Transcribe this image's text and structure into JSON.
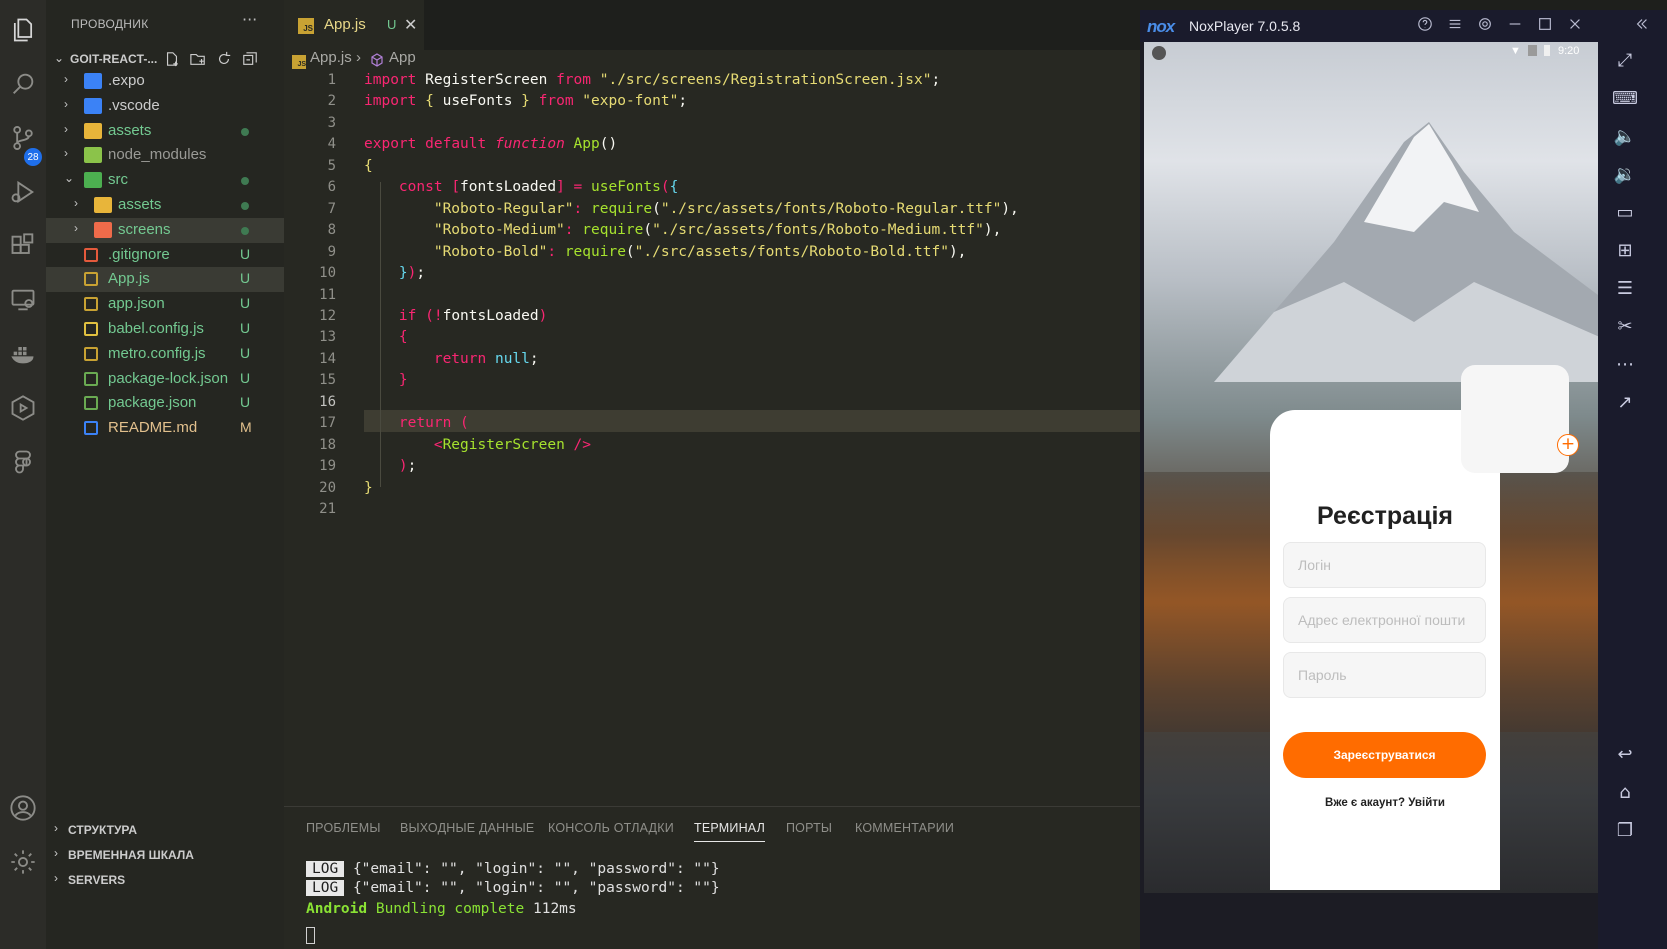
{
  "sidebar": {
    "title": "ПРОВОДНИК",
    "more": "···",
    "root": "GOIT-REACT-...",
    "items": [
      {
        "name": ".expo",
        "status": "",
        "indent": 1,
        "folder": true,
        "open": false,
        "color": "#3b82f6",
        "text_color": "#cccccc"
      },
      {
        "name": ".vscode",
        "status": "",
        "indent": 1,
        "folder": true,
        "open": false,
        "color": "#3b82f6",
        "text_color": "#cccccc"
      },
      {
        "name": "assets",
        "status": "dot",
        "indent": 1,
        "folder": true,
        "open": false,
        "color": "#e8b53a",
        "text_color": "#73c991"
      },
      {
        "name": "node_modules",
        "status": "",
        "indent": 1,
        "folder": true,
        "open": false,
        "color": "#8bc34a",
        "text_color": "#9a9a96"
      },
      {
        "name": "src",
        "status": "dot",
        "indent": 1,
        "folder": true,
        "open": true,
        "color": "#4caf50",
        "text_color": "#73c991"
      },
      {
        "name": "assets",
        "status": "dot",
        "indent": 2,
        "folder": true,
        "open": false,
        "color": "#e8b53a",
        "text_color": "#73c991"
      },
      {
        "name": "screens",
        "status": "dot",
        "indent": 2,
        "folder": true,
        "open": false,
        "color": "#ef6b4a",
        "text_color": "#73c991"
      },
      {
        "name": ".gitignore",
        "status": "U",
        "indent": 1,
        "folder": false,
        "color": "#e45a3c",
        "text_color": "#73c991"
      },
      {
        "name": "App.js",
        "status": "U",
        "indent": 1,
        "folder": false,
        "color": "#c8a233",
        "text_color": "#73c991"
      },
      {
        "name": "app.json",
        "status": "U",
        "indent": 1,
        "folder": false,
        "color": "#c8a233",
        "text_color": "#73c991"
      },
      {
        "name": "babel.config.js",
        "status": "U",
        "indent": 1,
        "folder": false,
        "color": "#e0c040",
        "text_color": "#73c991"
      },
      {
        "name": "metro.config.js",
        "status": "U",
        "indent": 1,
        "folder": false,
        "color": "#c8a233",
        "text_color": "#73c991"
      },
      {
        "name": "package-lock.json",
        "status": "U",
        "indent": 1,
        "folder": false,
        "color": "#6aaa52",
        "text_color": "#73c991"
      },
      {
        "name": "package.json",
        "status": "U",
        "indent": 1,
        "folder": false,
        "color": "#6aaa52",
        "text_color": "#73c991"
      },
      {
        "name": "README.md",
        "status": "M",
        "indent": 1,
        "folder": false,
        "color": "#3b82f6",
        "text_color": "#e2c08d"
      }
    ],
    "sections": [
      "СТРУКТУРА",
      "ВРЕМЕННАЯ ШКАЛА",
      "SERVERS"
    ]
  },
  "activity": {
    "scm_badge": "28"
  },
  "tab": {
    "name": "App.js",
    "status": "U",
    "close": "✕"
  },
  "breadcrumb": {
    "file": "App.js",
    "symbol": "App"
  },
  "editor": {
    "active_line": 16,
    "lines": [
      [
        [
          "kw",
          "import"
        ],
        [
          "br",
          " RegisterScreen "
        ],
        [
          "kw",
          "from"
        ],
        [
          "br",
          " "
        ],
        [
          "str",
          "\"./src/screens/RegistrationScreen.jsx\""
        ],
        [
          "br",
          ";"
        ]
      ],
      [
        [
          "kw",
          "import"
        ],
        [
          "br",
          " "
        ],
        [
          "ye",
          "{"
        ],
        [
          "br",
          " useFonts "
        ],
        [
          "ye",
          "}"
        ],
        [
          "br",
          " "
        ],
        [
          "kw",
          "from"
        ],
        [
          "br",
          " "
        ],
        [
          "str",
          "\"expo-font\""
        ],
        [
          "br",
          ";"
        ]
      ],
      [],
      [
        [
          "kw",
          "export"
        ],
        [
          "br",
          " "
        ],
        [
          "kw",
          "default"
        ],
        [
          "br",
          " "
        ],
        [
          "it",
          "function"
        ],
        [
          "br",
          " "
        ],
        [
          "fn",
          "App"
        ],
        [
          "br",
          "()"
        ]
      ],
      [
        [
          "ye",
          "{"
        ]
      ],
      [
        [
          "br",
          "    "
        ],
        [
          "kw",
          "const"
        ],
        [
          "br",
          " "
        ],
        [
          "kw",
          "["
        ],
        [
          "br",
          "fontsLoaded"
        ],
        [
          "kw",
          "]"
        ],
        [
          "br",
          " "
        ],
        [
          "kw",
          "="
        ],
        [
          "br",
          " "
        ],
        [
          "fn",
          "useFonts"
        ],
        [
          "kw",
          "("
        ],
        [
          "cn",
          "{"
        ]
      ],
      [
        [
          "br",
          "        "
        ],
        [
          "str",
          "\"Roboto-Regular\""
        ],
        [
          "kw",
          ":"
        ],
        [
          "br",
          " "
        ],
        [
          "fn",
          "require"
        ],
        [
          "br",
          "("
        ],
        [
          "str",
          "\"./src/assets/fonts/Roboto-Regular.ttf\""
        ],
        [
          "br",
          "),"
        ]
      ],
      [
        [
          "br",
          "        "
        ],
        [
          "str",
          "\"Roboto-Medium\""
        ],
        [
          "kw",
          ":"
        ],
        [
          "br",
          " "
        ],
        [
          "fn",
          "require"
        ],
        [
          "br",
          "("
        ],
        [
          "str",
          "\"./src/assets/fonts/Roboto-Medium.ttf\""
        ],
        [
          "br",
          "),"
        ]
      ],
      [
        [
          "br",
          "        "
        ],
        [
          "str",
          "\"Roboto-Bold\""
        ],
        [
          "kw",
          ":"
        ],
        [
          "br",
          " "
        ],
        [
          "fn",
          "require"
        ],
        [
          "br",
          "("
        ],
        [
          "str",
          "\"./src/assets/fonts/Roboto-Bold.ttf\""
        ],
        [
          "br",
          "),"
        ]
      ],
      [
        [
          "br",
          "    "
        ],
        [
          "cn",
          "}"
        ],
        [
          "kw",
          ")"
        ],
        [
          "br",
          ";"
        ]
      ],
      [],
      [
        [
          "br",
          "    "
        ],
        [
          "kw",
          "if"
        ],
        [
          "br",
          " "
        ],
        [
          "kw",
          "(!"
        ],
        [
          "br",
          "fontsLoaded"
        ],
        [
          "kw",
          ")"
        ]
      ],
      [
        [
          "br",
          "    "
        ],
        [
          "kw",
          "{"
        ]
      ],
      [
        [
          "br",
          "        "
        ],
        [
          "kw",
          "return"
        ],
        [
          "br",
          " "
        ],
        [
          "cn",
          "null"
        ],
        [
          "br",
          ";"
        ]
      ],
      [
        [
          "br",
          "    "
        ],
        [
          "kw",
          "}"
        ]
      ],
      [],
      [
        [
          "br",
          "    "
        ],
        [
          "kw",
          "return"
        ],
        [
          "br",
          " "
        ],
        [
          "kw",
          "("
        ]
      ],
      [
        [
          "br",
          "        "
        ],
        [
          "kw",
          "<"
        ],
        [
          "fn",
          "RegisterScreen"
        ],
        [
          "br",
          " "
        ],
        [
          "kw",
          "/>"
        ]
      ],
      [
        [
          "br",
          "    "
        ],
        [
          "kw",
          ")"
        ],
        [
          "br",
          ";"
        ]
      ],
      [
        [
          "ye",
          "}"
        ]
      ],
      []
    ]
  },
  "panel": {
    "tabs": [
      "ПРОБЛЕМЫ",
      "ВЫХОДНЫЕ ДАННЫЕ",
      "КОНСОЛЬ ОТЛАДКИ",
      "ТЕРМИНАЛ",
      "ПОРТЫ",
      "КОММЕНТАРИИ"
    ],
    "active_tab": "ТЕРМИНАЛ",
    "log_label": "LOG",
    "log_lines": [
      "{\"email\": \"\", \"login\": \"\", \"password\": \"\"}",
      "{\"email\": \"\", \"login\": \"\", \"password\": \"\"}"
    ],
    "bundle_prefix": "Android",
    "bundle_text": " Bundling complete ",
    "bundle_time": "112ms"
  },
  "nox": {
    "logo": "nox",
    "title": "NoxPlayer 7.0.5.8",
    "time": "9:20",
    "screen": {
      "title": "Реєстрація",
      "login_placeholder": "Логін",
      "email_placeholder": "Адрес електронної пошти",
      "password_placeholder": "Пароль",
      "register_button": "Зареєструватися",
      "login_link": "Вже є акаунт? Увійти",
      "plus": "+"
    }
  },
  "colors": {
    "accent": "#ff6c00",
    "git_untracked": "#73c991",
    "git_modified": "#e2c08d"
  }
}
